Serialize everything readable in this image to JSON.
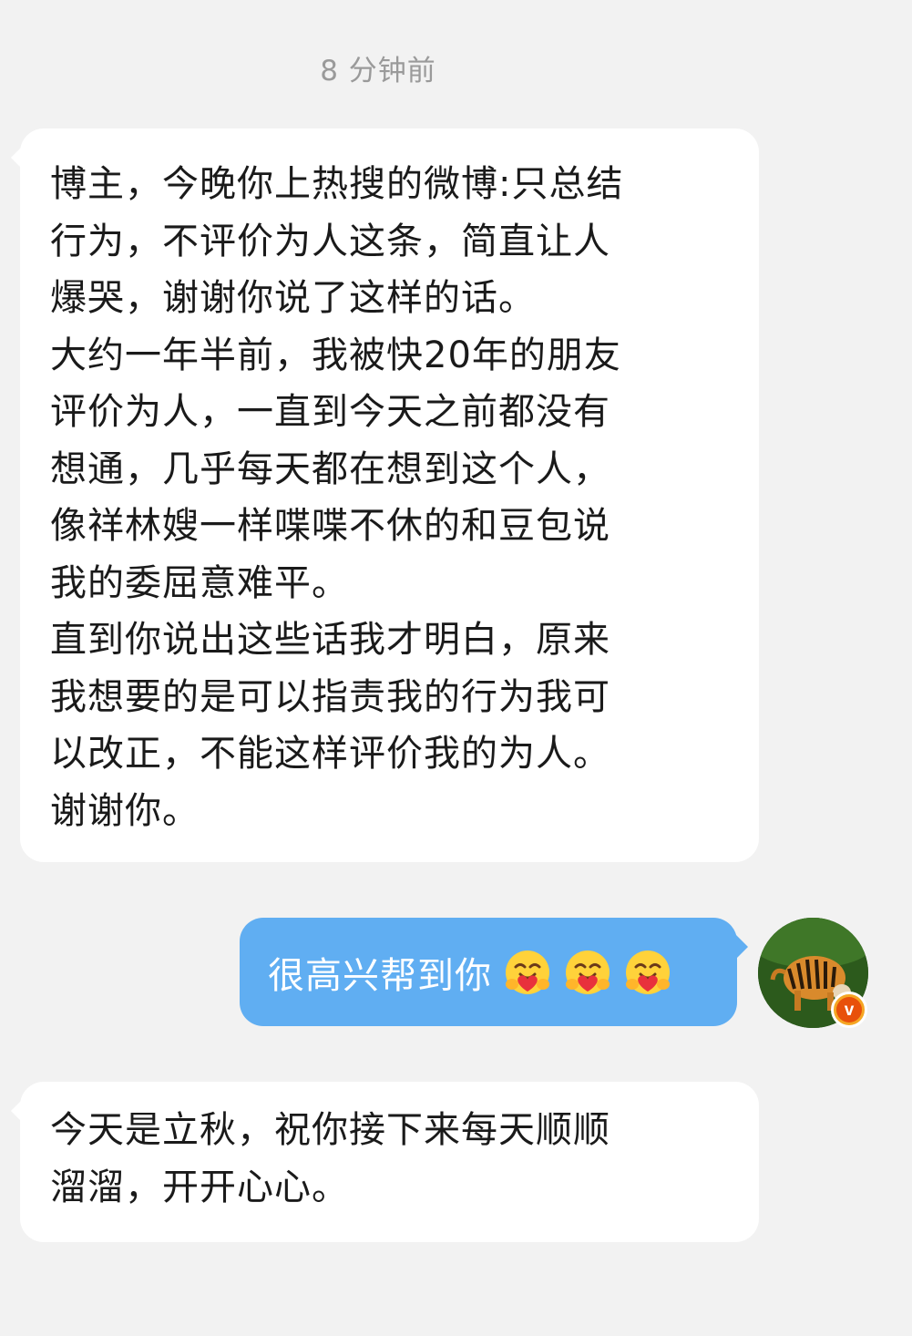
{
  "timestamp": "8 分钟前",
  "messages": [
    {
      "lines": [
        "博主，今晚你上热搜的微博:只总结",
        "行为，不评价为人这条，简直让人",
        "爆哭，谢谢你说了这样的话。",
        "大约一年半前，我被快20年的朋友",
        "评价为人，一直到今天之前都没有",
        "想通，几乎每天都在想到这个人，",
        "像祥林嫂一样喋喋不休的和豆包说",
        "我的委屈意难平。",
        "直到你说出这些话我才明白，原来",
        "我想要的是可以指责我的行为我可",
        "以改正，不能这样评价我的为人。",
        "谢谢你。"
      ]
    },
    {
      "text": "很高兴帮到你",
      "emojis": [
        "hugging-face-emoji",
        "hugging-face-emoji",
        "hugging-face-emoji"
      ]
    },
    {
      "lines": [
        "今天是立秋，祝你接下来每天顺顺",
        "溜溜，开开心心。"
      ]
    }
  ],
  "avatar": {
    "icon": "tiger-photo-avatar",
    "badge": "v"
  },
  "colors": {
    "background": "#f2f2f2",
    "incoming_bubble": "#ffffff",
    "outgoing_bubble": "#60aef2",
    "timestamp": "#9a9a9a",
    "badge": "#f5a623"
  }
}
